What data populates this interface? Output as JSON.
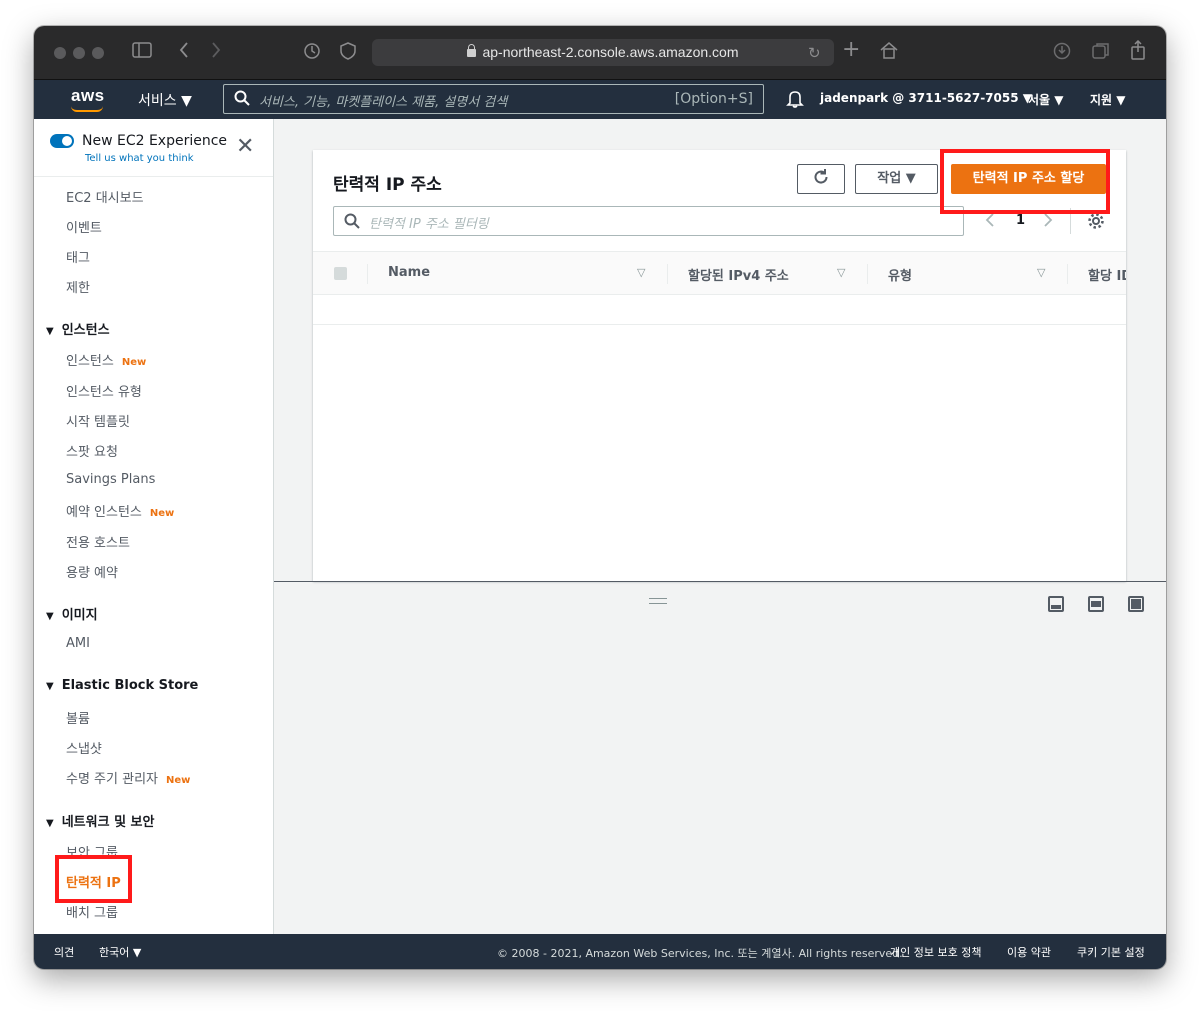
{
  "browser": {
    "url": "ap-northeast-2.console.aws.amazon.com"
  },
  "awsnav": {
    "logo": "aws",
    "services": "서비스 ▼",
    "search_placeholder": "서비스, 기능, 마켓플레이스 제품, 설명서 검색",
    "search_shortcut": "[Option+S]",
    "account": "jadenpark @ 3711-5627-7055 ▼",
    "region": "서울 ▼",
    "support": "지원 ▼"
  },
  "sidebar": {
    "experience_title": "New EC2 Experience",
    "experience_sub": "Tell us what you think",
    "new_badge": "New",
    "top_links": [
      "EC2 대시보드",
      "이벤트",
      "태그",
      "제한"
    ],
    "sections": {
      "instances": {
        "title": "인스턴스",
        "items": [
          "인스턴스",
          "인스턴스 유형",
          "시작 템플릿",
          "스팟 요청",
          "Savings Plans",
          "예약 인스턴스",
          "전용 호스트",
          "용량 예약"
        ]
      },
      "images": {
        "title": "이미지",
        "items": [
          "AMI"
        ]
      },
      "ebs": {
        "title": "Elastic Block Store",
        "items": [
          "볼륨",
          "스냅샷",
          "수명 주기 관리자"
        ]
      },
      "network": {
        "title": "네트워크 및 보안",
        "items": [
          "보안 그룹",
          "탄력적 IP",
          "배치 그룹"
        ]
      }
    }
  },
  "panel": {
    "title": "탄력적 IP 주소",
    "actions_label": "작업 ▼",
    "allocate_label": "탄력적 IP 주소 할당",
    "filter_placeholder": "탄력적 IP 주소 필터링",
    "page": "1",
    "columns": [
      "Name",
      "할당된 IPv4 주소",
      "유형",
      "할당 ID"
    ]
  },
  "footer": {
    "feedback": "의견",
    "language": "한국어 ▼",
    "copyright": "© 2008 - 2021, Amazon Web Services, Inc. 또는 계열사. All rights reserved.",
    "privacy": "개인 정보 보호 정책",
    "terms": "이용 약관",
    "cookies": "쿠키 기본 설정"
  },
  "colors": {
    "aws_nav": "#232f3e",
    "accent_orange": "#ec7211",
    "link_blue": "#0073bb",
    "highlight_red": "#ff1a1a"
  }
}
